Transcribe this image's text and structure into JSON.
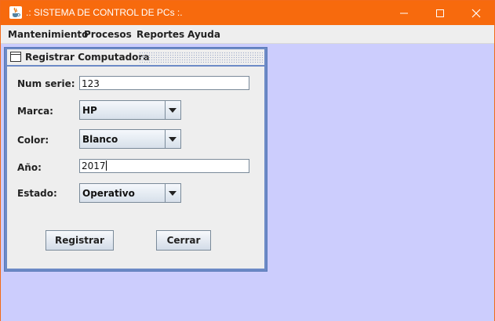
{
  "window": {
    "title": ".: SISTEMA DE CONTROL DE PCs :.",
    "accent_color": "#f76a0d",
    "desktop_color": "#cccdfd"
  },
  "menubar": {
    "items": [
      {
        "label": "Mantenimiento"
      },
      {
        "label": "Procesos"
      },
      {
        "label": "Reportes"
      },
      {
        "label": "Ayuda"
      }
    ]
  },
  "form": {
    "title": "Registrar Computadora",
    "fields": {
      "num_serie": {
        "label": "Num serie:",
        "value": "123"
      },
      "marca": {
        "label": "Marca:",
        "value": "HP"
      },
      "color": {
        "label": "Color:",
        "value": "Blanco"
      },
      "anio": {
        "label": "Año:",
        "value": "2017"
      },
      "estado": {
        "label": "Estado:",
        "value": "Operativo"
      }
    },
    "buttons": {
      "registrar": "Registrar",
      "cerrar": "Cerrar"
    }
  },
  "icons": {
    "app": "java-cup-icon",
    "frame": "internal-frame-icon",
    "minimize": "minimize-icon",
    "maximize": "maximize-icon",
    "close": "close-icon",
    "dropdown": "chevron-down-icon"
  }
}
